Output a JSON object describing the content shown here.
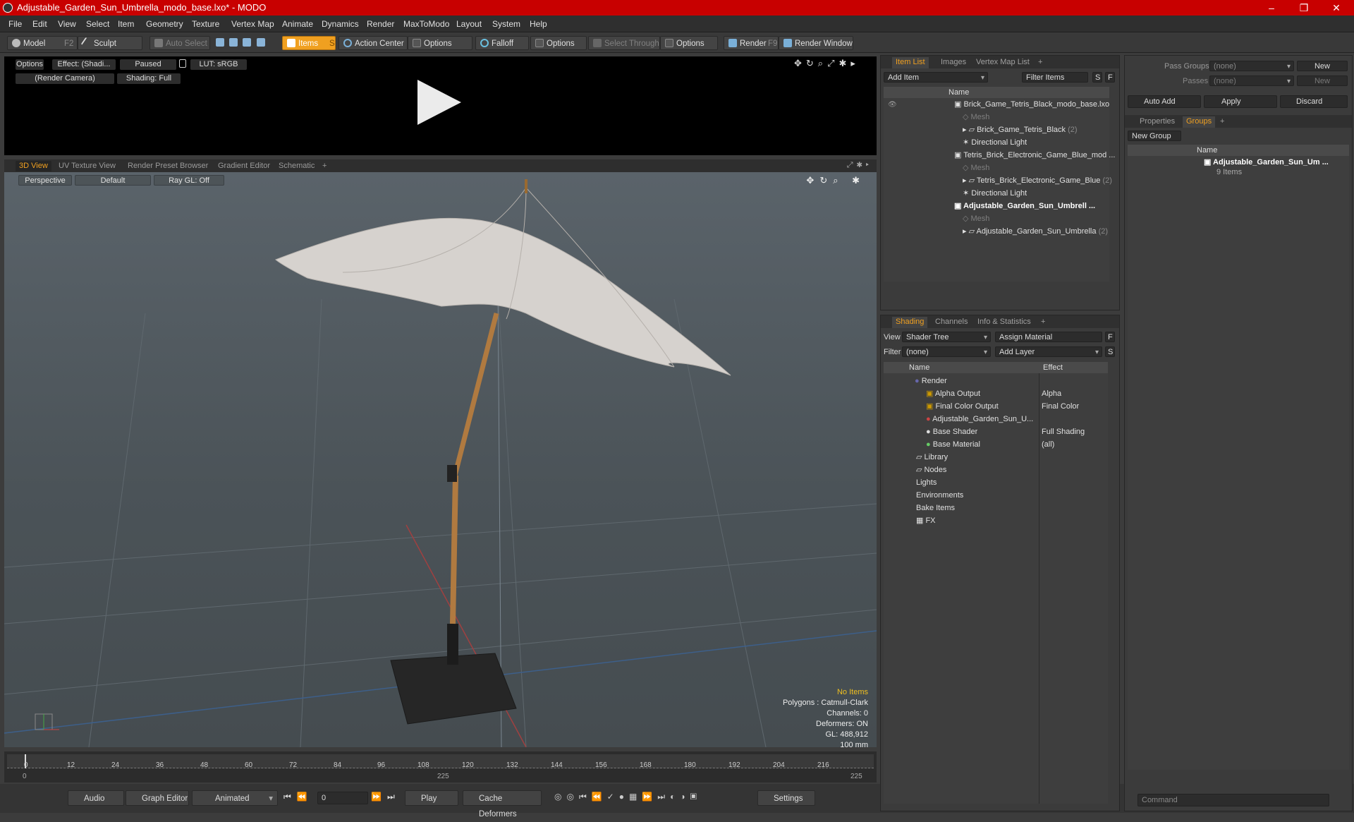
{
  "window": {
    "title": "Adjustable_Garden_Sun_Umbrella_modo_base.lxo* - MODO",
    "minimize": "–",
    "maximize": "❐",
    "close": "✕"
  },
  "menu": [
    "File",
    "Edit",
    "View",
    "Select",
    "Item",
    "Geometry",
    "Texture",
    "Vertex Map",
    "Animate",
    "Dynamics",
    "Render",
    "MaxToModo",
    "Layout",
    "System",
    "Help"
  ],
  "toolbar": {
    "model": "Model",
    "model_key": "F2",
    "sculpt": "Sculpt",
    "auto_select": "Auto Select",
    "items": "Items",
    "items_key": "S",
    "action_center": "Action Center",
    "options1": "Options",
    "falloff": "Falloff",
    "options2": "Options",
    "select_through": "Select Through",
    "options3": "Options",
    "render": "Render",
    "render_key": "F9",
    "render_window": "Render Window"
  },
  "preview": {
    "options": "Options",
    "effect": "Effect: (Shadi...",
    "paused": "Paused",
    "lut": "LUT: sRGB",
    "camera": "(Render Camera)",
    "shading": "Shading: Full"
  },
  "viewport_tabs": [
    "3D View",
    "UV Texture View",
    "Render Preset Browser",
    "Gradient Editor",
    "Schematic",
    "+"
  ],
  "viewport": {
    "perspective": "Perspective",
    "default": "Default",
    "raygl": "Ray GL: Off",
    "info": {
      "items": "No Items",
      "polygons": "Polygons : Catmull-Clark",
      "channels": "Channels: 0",
      "deformers": "Deformers: ON",
      "gl": "GL: 488,912",
      "size": "100 mm"
    }
  },
  "timeline": {
    "ticks": [
      "0",
      "12",
      "24",
      "36",
      "48",
      "60",
      "72",
      "84",
      "96",
      "108",
      "120",
      "132",
      "144",
      "156",
      "168",
      "180",
      "192",
      "204",
      "216"
    ],
    "start": "0",
    "mid": "225",
    "end": "225"
  },
  "bottom": {
    "audio": "Audio",
    "graph_editor": "Graph Editor",
    "animated": "Animated",
    "frame": "0",
    "play": "Play",
    "cache": "Cache Deformers",
    "settings": "Settings"
  },
  "item_list": {
    "tabs": [
      "Item List",
      "Images",
      "Vertex Map List",
      "+"
    ],
    "add_item": "Add Item",
    "filter": "Filter Items",
    "s": "S",
    "f": "F",
    "name_col": "Name",
    "rows": [
      {
        "label": "Brick_Game_Tetris_Black_modo_base.lxo",
        "count": "",
        "style": "scene"
      },
      {
        "label": "Mesh",
        "count": "",
        "style": "dim"
      },
      {
        "label": "Brick_Game_Tetris_Black",
        "count": "(2)",
        "style": "group"
      },
      {
        "label": "Directional Light",
        "count": "",
        "style": "light"
      },
      {
        "label": "Tetris_Brick_Electronic_Game_Blue_mod ...",
        "count": "",
        "style": "scene"
      },
      {
        "label": "Mesh",
        "count": "",
        "style": "dim"
      },
      {
        "label": "Tetris_Brick_Electronic_Game_Blue",
        "count": "(2)",
        "style": "group"
      },
      {
        "label": "Directional Light",
        "count": "",
        "style": "light"
      },
      {
        "label": "Adjustable_Garden_Sun_Umbrell ...",
        "count": "",
        "style": "scene-bold"
      },
      {
        "label": "Mesh",
        "count": "",
        "style": "dim"
      },
      {
        "label": "Adjustable_Garden_Sun_Umbrella",
        "count": "(2)",
        "style": "group"
      }
    ]
  },
  "shading": {
    "tabs": [
      "Shading",
      "Channels",
      "Info & Statistics",
      "+"
    ],
    "view_label": "View",
    "view_value": "Shader Tree",
    "assign": "Assign Material",
    "f": "F",
    "filter_label": "Filter",
    "filter_value": "(none)",
    "add_layer": "Add Layer",
    "s": "S",
    "name_col": "Name",
    "effect_col": "Effect",
    "rows": [
      {
        "label": "Render",
        "effect": ""
      },
      {
        "label": "Alpha Output",
        "effect": "Alpha"
      },
      {
        "label": "Final Color Output",
        "effect": "Final Color"
      },
      {
        "label": "Adjustable_Garden_Sun_U...",
        "effect": ""
      },
      {
        "label": "Base Shader",
        "effect": "Full Shading"
      },
      {
        "label": "Base Material",
        "effect": "(all)"
      },
      {
        "label": "Library",
        "effect": ""
      },
      {
        "label": "Nodes",
        "effect": ""
      },
      {
        "label": "Lights",
        "effect": ""
      },
      {
        "label": "Environments",
        "effect": ""
      },
      {
        "label": "Bake Items",
        "effect": ""
      },
      {
        "label": "FX",
        "effect": ""
      }
    ]
  },
  "groups": {
    "pass_groups": "Pass Groups",
    "pass_value": "(none)",
    "new": "New",
    "passes": "Passes",
    "passes_value": "(none)",
    "new2": "New",
    "auto_add": "Auto Add",
    "apply": "Apply",
    "discard": "Discard",
    "tabs": [
      "Properties",
      "Groups",
      "+"
    ],
    "new_group": "New Group",
    "name_col": "Name",
    "group_name": "Adjustable_Garden_Sun_Um ...",
    "group_count": "9 Items"
  },
  "command": {
    "placeholder": "Command"
  }
}
